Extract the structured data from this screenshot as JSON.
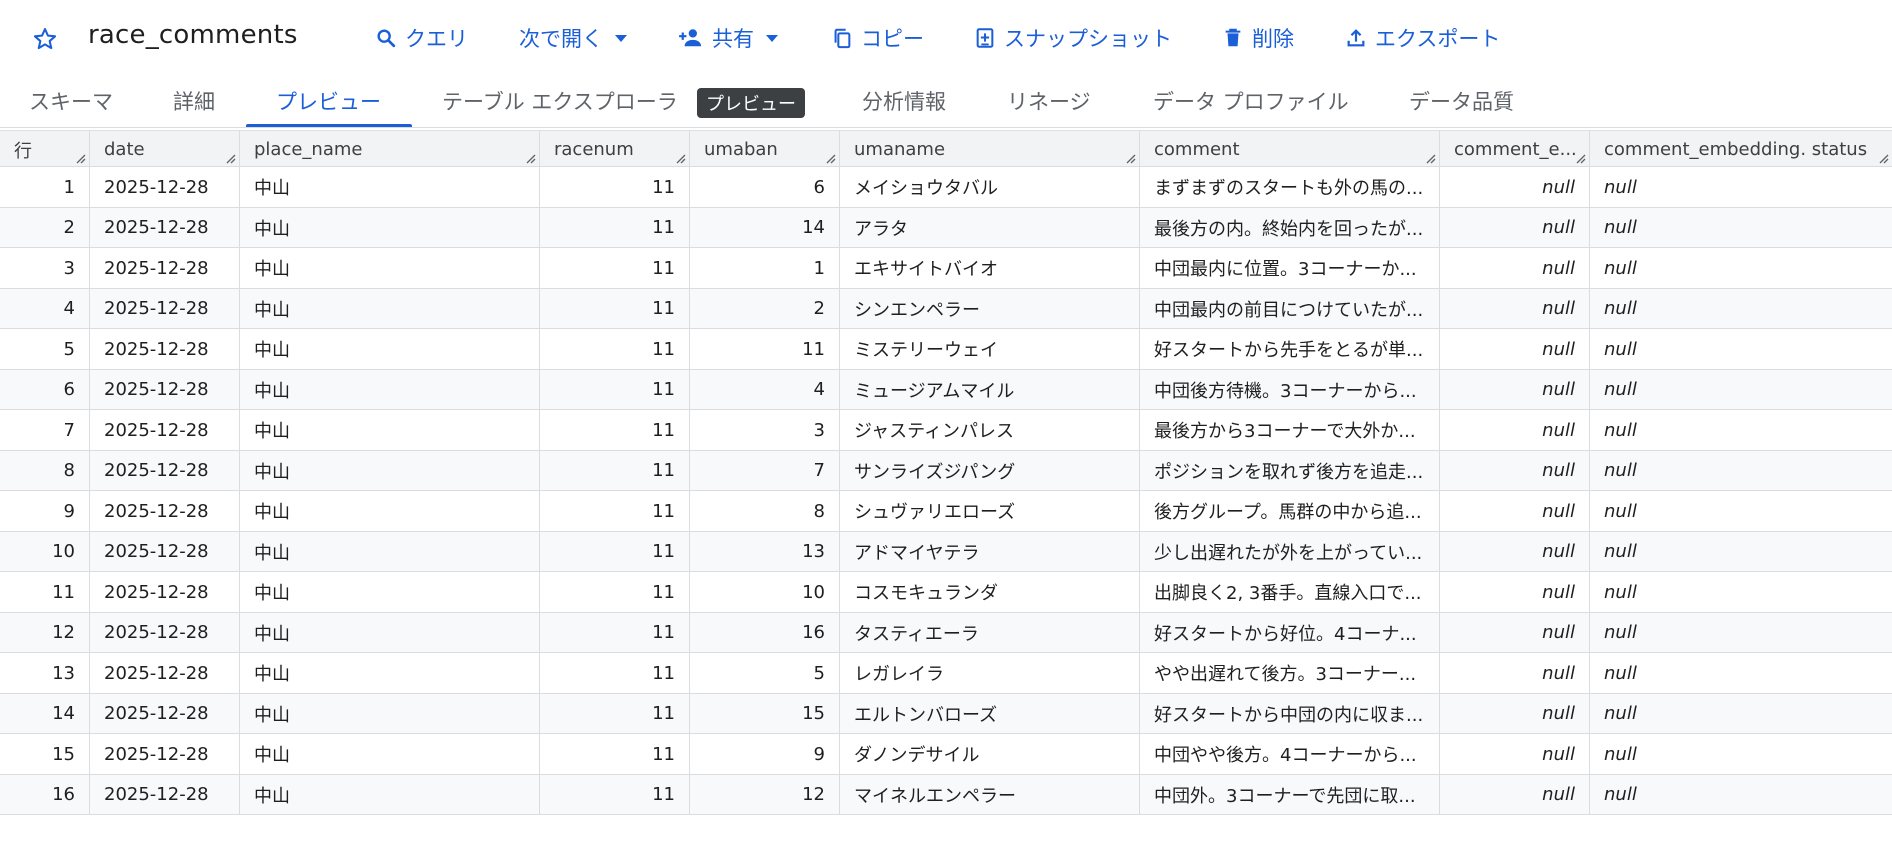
{
  "header": {
    "title": "race_comments",
    "actions": {
      "query": "クエリ",
      "open_in": "次で開く",
      "share": "共有",
      "copy": "コピー",
      "snapshot": "スナップショット",
      "delete": "削除",
      "export": "エクスポート"
    }
  },
  "tabs": {
    "schema": "スキーマ",
    "details": "詳細",
    "preview": "プレビュー",
    "table_explorer": "テーブル エクスプローラ",
    "table_explorer_badge": "プレビュー",
    "insights": "分析情報",
    "lineage": "リネージ",
    "data_profile": "データ プロファイル",
    "data_quality": "データ品質"
  },
  "columns": {
    "row": "行",
    "date": "date",
    "place_name": "place_name",
    "racenum": "racenum",
    "umaban": "umaban",
    "umaname": "umaname",
    "comment": "comment",
    "comment_e": "comment_e...",
    "comment_embedding_status": "comment_embedding. status"
  },
  "rows": [
    {
      "row": "1",
      "date": "2025-12-28",
      "place_name": "中山",
      "racenum": "11",
      "umaban": "6",
      "umaname": "メイショウタバル",
      "comment": "まずまずのスタートも外の馬の...",
      "comment_e": "null",
      "status": "null"
    },
    {
      "row": "2",
      "date": "2025-12-28",
      "place_name": "中山",
      "racenum": "11",
      "umaban": "14",
      "umaname": "アラタ",
      "comment": "最後方の内。終始内を回ったが...",
      "comment_e": "null",
      "status": "null"
    },
    {
      "row": "3",
      "date": "2025-12-28",
      "place_name": "中山",
      "racenum": "11",
      "umaban": "1",
      "umaname": "エキサイトバイオ",
      "comment": "中団最内に位置。3コーナーか...",
      "comment_e": "null",
      "status": "null"
    },
    {
      "row": "4",
      "date": "2025-12-28",
      "place_name": "中山",
      "racenum": "11",
      "umaban": "2",
      "umaname": "シンエンペラー",
      "comment": "中団最内の前目につけていたが...",
      "comment_e": "null",
      "status": "null"
    },
    {
      "row": "5",
      "date": "2025-12-28",
      "place_name": "中山",
      "racenum": "11",
      "umaban": "11",
      "umaname": "ミステリーウェイ",
      "comment": "好スタートから先手をとるが単...",
      "comment_e": "null",
      "status": "null"
    },
    {
      "row": "6",
      "date": "2025-12-28",
      "place_name": "中山",
      "racenum": "11",
      "umaban": "4",
      "umaname": "ミュージアムマイル",
      "comment": "中団後方待機。3コーナーから...",
      "comment_e": "null",
      "status": "null"
    },
    {
      "row": "7",
      "date": "2025-12-28",
      "place_name": "中山",
      "racenum": "11",
      "umaban": "3",
      "umaname": "ジャスティンパレス",
      "comment": "最後方から3コーナーで大外か...",
      "comment_e": "null",
      "status": "null"
    },
    {
      "row": "8",
      "date": "2025-12-28",
      "place_name": "中山",
      "racenum": "11",
      "umaban": "7",
      "umaname": "サンライズジパング",
      "comment": "ポジションを取れず後方を追走...",
      "comment_e": "null",
      "status": "null"
    },
    {
      "row": "9",
      "date": "2025-12-28",
      "place_name": "中山",
      "racenum": "11",
      "umaban": "8",
      "umaname": "シュヴァリエローズ",
      "comment": "後方グループ。馬群の中から追...",
      "comment_e": "null",
      "status": "null"
    },
    {
      "row": "10",
      "date": "2025-12-28",
      "place_name": "中山",
      "racenum": "11",
      "umaban": "13",
      "umaname": "アドマイヤテラ",
      "comment": "少し出遅れたが外を上がってい...",
      "comment_e": "null",
      "status": "null"
    },
    {
      "row": "11",
      "date": "2025-12-28",
      "place_name": "中山",
      "racenum": "11",
      "umaban": "10",
      "umaname": "コスモキュランダ",
      "comment": "出脚良く2, 3番手。直線入口で...",
      "comment_e": "null",
      "status": "null"
    },
    {
      "row": "12",
      "date": "2025-12-28",
      "place_name": "中山",
      "racenum": "11",
      "umaban": "16",
      "umaname": "タスティエーラ",
      "comment": "好スタートから好位。4コーナ...",
      "comment_e": "null",
      "status": "null"
    },
    {
      "row": "13",
      "date": "2025-12-28",
      "place_name": "中山",
      "racenum": "11",
      "umaban": "5",
      "umaname": "レガレイラ",
      "comment": "やや出遅れて後方。3コーナー...",
      "comment_e": "null",
      "status": "null"
    },
    {
      "row": "14",
      "date": "2025-12-28",
      "place_name": "中山",
      "racenum": "11",
      "umaban": "15",
      "umaname": "エルトンバローズ",
      "comment": "好スタートから中団の内に収ま...",
      "comment_e": "null",
      "status": "null"
    },
    {
      "row": "15",
      "date": "2025-12-28",
      "place_name": "中山",
      "racenum": "11",
      "umaban": "9",
      "umaname": "ダノンデサイル",
      "comment": "中団やや後方。4コーナーから...",
      "comment_e": "null",
      "status": "null"
    },
    {
      "row": "16",
      "date": "2025-12-28",
      "place_name": "中山",
      "racenum": "11",
      "umaban": "12",
      "umaname": "マイネルエンペラー",
      "comment": "中団外。3コーナーで先団に取...",
      "comment_e": "null",
      "status": "null"
    }
  ],
  "theme": {
    "accent": "#1a5fd8",
    "header_bg": "#f1f3f4",
    "badge_bg": "#3c4043"
  }
}
